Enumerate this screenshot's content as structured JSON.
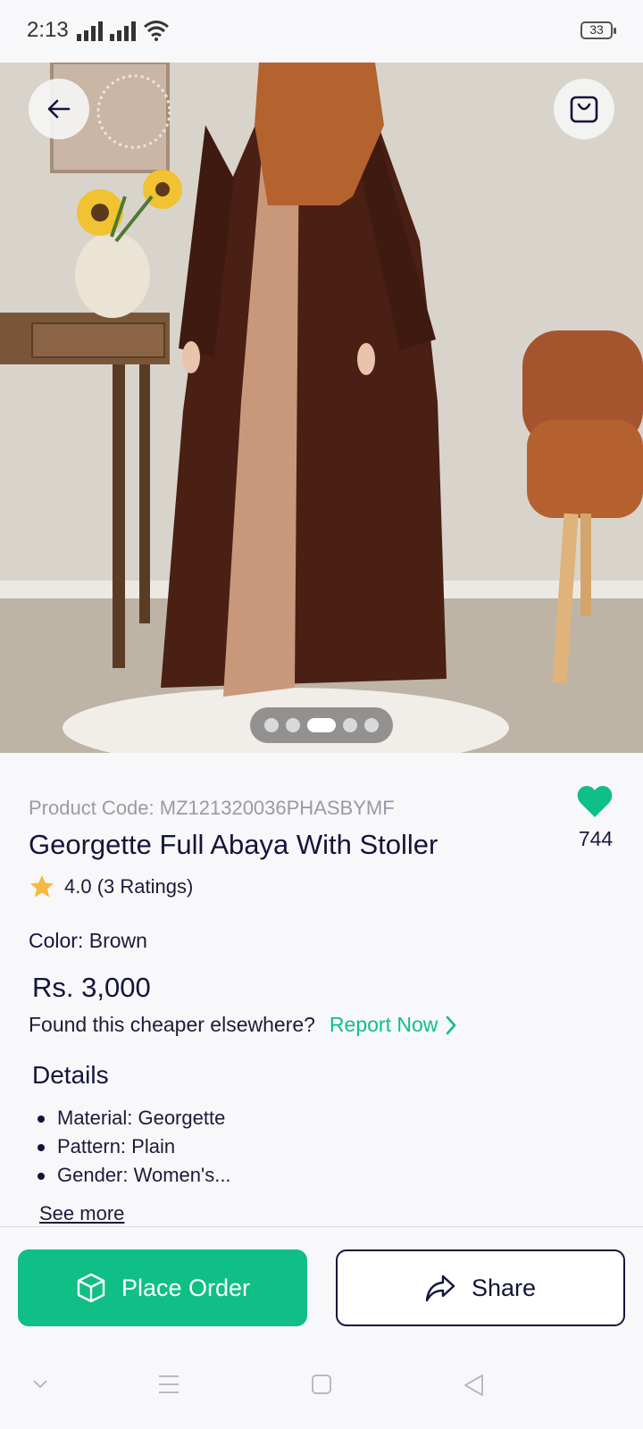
{
  "status_bar": {
    "time": "2:13",
    "battery": "33"
  },
  "product": {
    "code": "Product Code: MZ121320036PHASBYMF",
    "title": "Georgette Full Abaya With Stoller",
    "likes": "744",
    "rating": "4.0 (3 Ratings)",
    "color_label": "Color:",
    "color_value": "Brown",
    "price": "Rs. 3,000",
    "cheaper_text": "Found this cheaper elsewhere?",
    "report_link": "Report Now",
    "details_title": "Details",
    "details": [
      "Material: Georgette",
      "Pattern: Plain",
      "Gender: Women's..."
    ],
    "see_more": "See more"
  },
  "carousel": {
    "count": 5,
    "active_index": 2
  },
  "actions": {
    "place_order": "Place Order",
    "share": "Share"
  },
  "colors": {
    "accent": "#0fbf86",
    "navy": "#14143a"
  }
}
